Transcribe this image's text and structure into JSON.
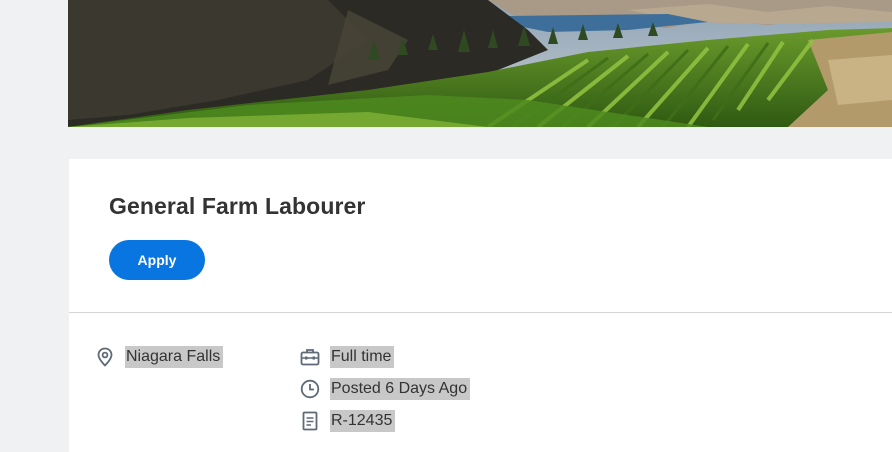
{
  "job": {
    "title": "General Farm Labourer",
    "apply_label": "Apply",
    "location": "Niagara Falls",
    "time_type": "Full time",
    "posted": "Posted 6 Days Ago",
    "requisition_id": "R-12435"
  },
  "icons": {
    "location": "location-pin-icon",
    "time_type": "briefcase-icon",
    "posted": "clock-icon",
    "requisition_id": "document-icon"
  },
  "colors": {
    "accent": "#0875e1",
    "page_background": "#f0f1f2",
    "text": "#333333",
    "icon": "#5e6a75",
    "highlight": "#c8c8c8"
  }
}
